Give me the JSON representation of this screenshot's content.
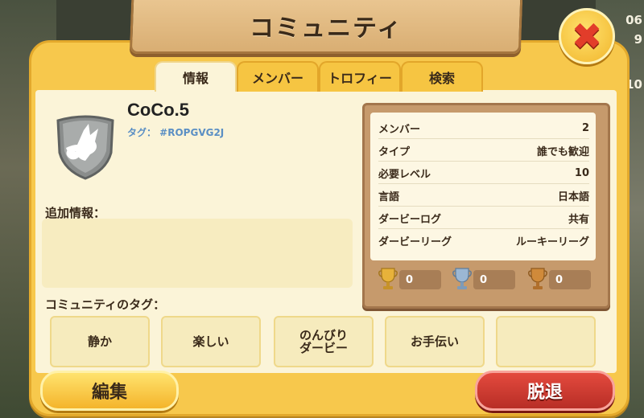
{
  "title": "コミュニティ",
  "tabs": [
    {
      "label": "情報",
      "active": true
    },
    {
      "label": "メンバー",
      "active": false
    },
    {
      "label": "トロフィー",
      "active": false
    },
    {
      "label": "検索",
      "active": false
    }
  ],
  "club": {
    "name": "CoCo.5",
    "tag": "タグ： #ROPGVG2J"
  },
  "additional_info": {
    "label": "追加情報：",
    "value": ""
  },
  "stats": [
    {
      "label": "メンバー",
      "value": "2"
    },
    {
      "label": "タイプ",
      "value": "誰でも歓迎"
    },
    {
      "label": "必要レベル",
      "value": "10"
    },
    {
      "label": "言語",
      "value": "日本語"
    },
    {
      "label": "ダービーログ",
      "value": "共有"
    },
    {
      "label": "ダービーリーグ",
      "value": "ルーキーリーグ"
    }
  ],
  "trophies": [
    {
      "type": "gold",
      "count": "0",
      "color": "#e7b23a"
    },
    {
      "type": "silver",
      "count": "0",
      "color": "#9bb7d4"
    },
    {
      "type": "bronze",
      "count": "0",
      "color": "#d08a3a"
    }
  ],
  "community_tags": {
    "label": "コミュニティのタグ：",
    "items": [
      "静か",
      "楽しい",
      "のんびり\nダービー",
      "お手伝い",
      ""
    ]
  },
  "buttons": {
    "edit": "編集",
    "leave": "脱退"
  },
  "background_numbers": [
    "06",
    "9",
    "10"
  ],
  "colors": {
    "accent": "#f7c84c",
    "leave": "#c8362c",
    "tag_text": "#5b8fc4"
  },
  "icons": {
    "close": "close-x-icon",
    "club_badge": "fox-shield-icon"
  }
}
